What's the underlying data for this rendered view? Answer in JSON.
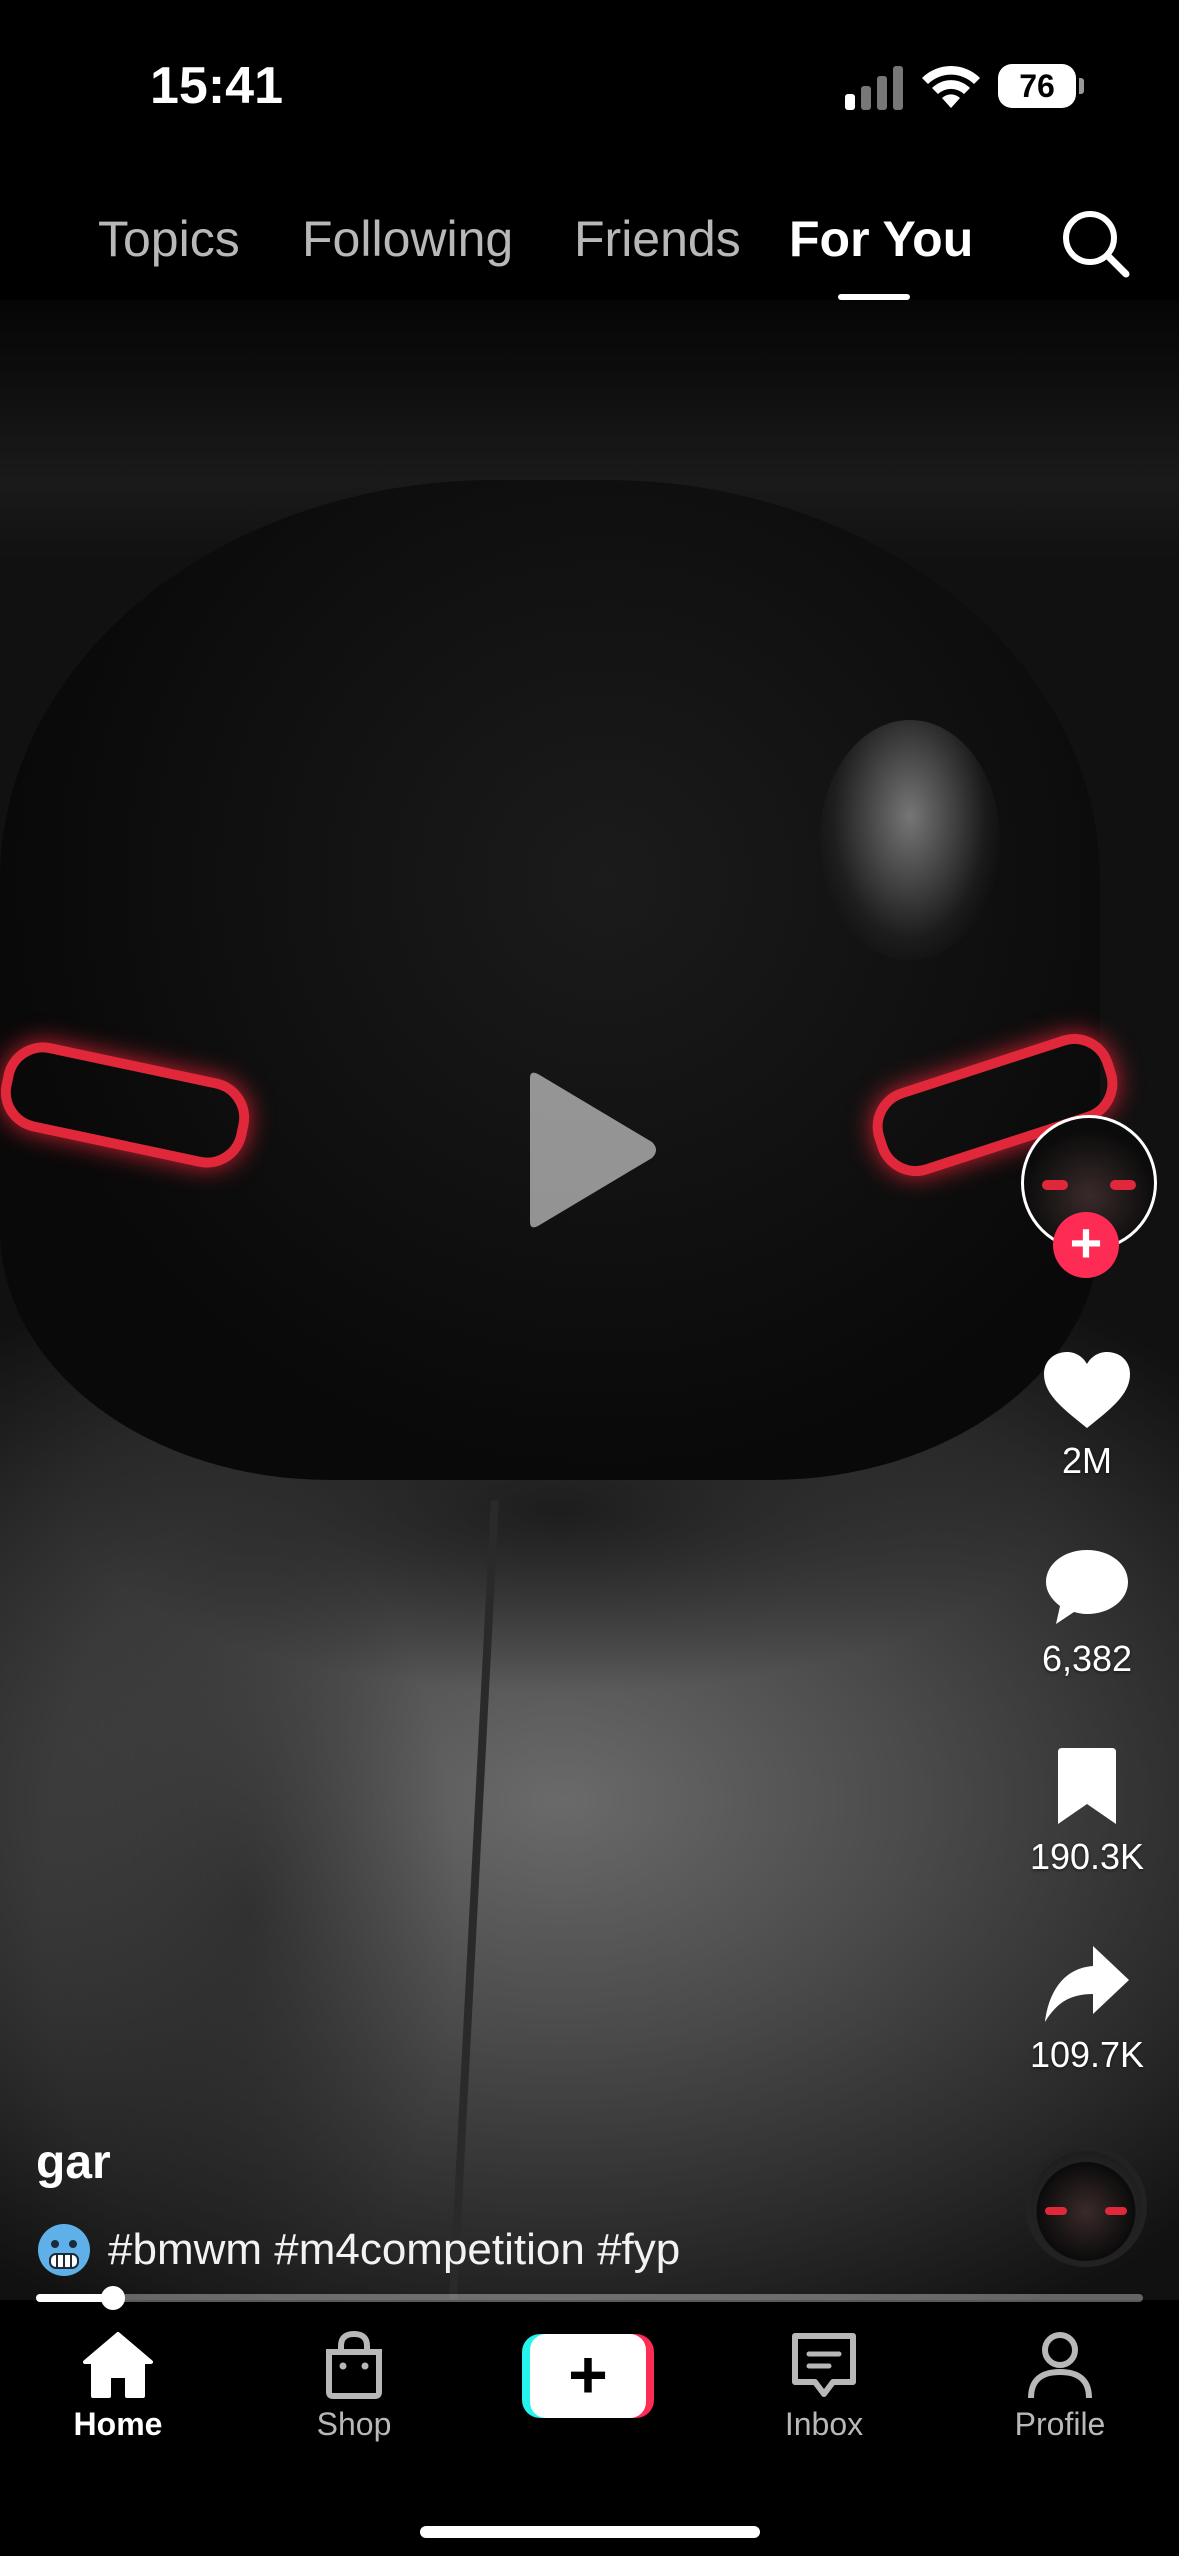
{
  "status_bar": {
    "time": "15:41",
    "battery": "76"
  },
  "top_nav": {
    "tabs": [
      {
        "label": "Topics",
        "active": false
      },
      {
        "label": "Following",
        "active": false
      },
      {
        "label": "Friends",
        "active": false
      },
      {
        "label": "For You",
        "active": true
      }
    ],
    "search_icon": "search-icon"
  },
  "video": {
    "state": "paused",
    "progress_fraction": 0.07
  },
  "actions": {
    "likes": "2M",
    "comments": "6,382",
    "bookmarks": "190.3K",
    "shares": "109.7K"
  },
  "post": {
    "username": "gar",
    "emoji": "freezing-face-emoji",
    "caption": "#bmwm #m4competition #fyp"
  },
  "bottom_nav": [
    {
      "label": "Home",
      "icon": "home-icon",
      "active": true
    },
    {
      "label": "Shop",
      "icon": "shop-bag-icon",
      "active": false
    },
    {
      "label": "",
      "icon": "create-plus-icon",
      "active": false
    },
    {
      "label": "Inbox",
      "icon": "inbox-icon",
      "active": false
    },
    {
      "label": "Profile",
      "icon": "profile-icon",
      "active": false
    }
  ],
  "colors": {
    "accent": "#fe2c55",
    "cyan": "#25f4ee"
  }
}
